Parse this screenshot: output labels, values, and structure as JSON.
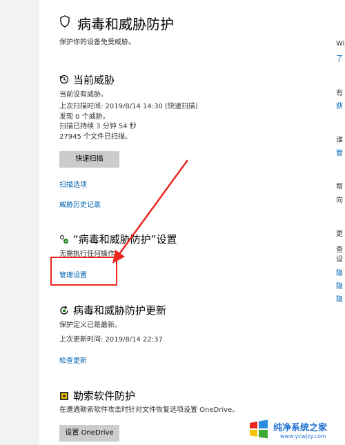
{
  "page": {
    "title": "病毒和威胁防护",
    "subtitle": "保护你的设备免受威胁。"
  },
  "current_threats": {
    "heading": "当前威胁",
    "lines": [
      "当前没有威胁。",
      "上次扫描时间: 2019/8/14 14:30 (快速扫描)",
      "发现 0 个威胁。",
      "扫描已持续 3 分钟 54 秒",
      "27945 个文件已扫描。"
    ],
    "quick_scan_button": "快速扫描",
    "scan_options_link": "扫描选项",
    "threat_history_link": "威胁历史记录"
  },
  "settings": {
    "heading": "“病毒和威胁防护”设置",
    "status": "无需执行任何操作。",
    "manage_link": "管理设置"
  },
  "updates": {
    "heading": "病毒和威胁防护更新",
    "lines": [
      "保护定义已是最新。",
      "上次更新时间: 2019/8/14 22:37"
    ],
    "check_link": "检查更新"
  },
  "ransomware": {
    "heading": "勒索软件防护",
    "description": "在遭遇勒索软件攻击时针对文件恢复选项设置 OneDrive。",
    "button": "设置 OneDrive"
  },
  "sidebar": {
    "items": [
      {
        "text": "Wi",
        "kind": "text"
      },
      {
        "text": "了",
        "kind": "link"
      },
      {
        "text": "有",
        "kind": "text"
      },
      {
        "text": "获",
        "kind": "link"
      },
      {
        "text": "谁",
        "kind": "text"
      },
      {
        "text": "管",
        "kind": "link"
      },
      {
        "text": "帮",
        "kind": "text"
      },
      {
        "text": "向",
        "kind": "text"
      },
      {
        "text": "更",
        "kind": "text"
      },
      {
        "text": "查",
        "kind": "text"
      },
      {
        "text": "设",
        "kind": "text"
      },
      {
        "text": "隐",
        "kind": "link"
      },
      {
        "text": "隐",
        "kind": "link"
      },
      {
        "text": "隐",
        "kind": "link"
      }
    ]
  },
  "watermark": {
    "brand": "纯净系统之家",
    "url": "www.ycwjzy.com"
  },
  "colors": {
    "link": "#0063b1",
    "button_bg": "#cccccc",
    "annotation_red": "#e8271f"
  }
}
